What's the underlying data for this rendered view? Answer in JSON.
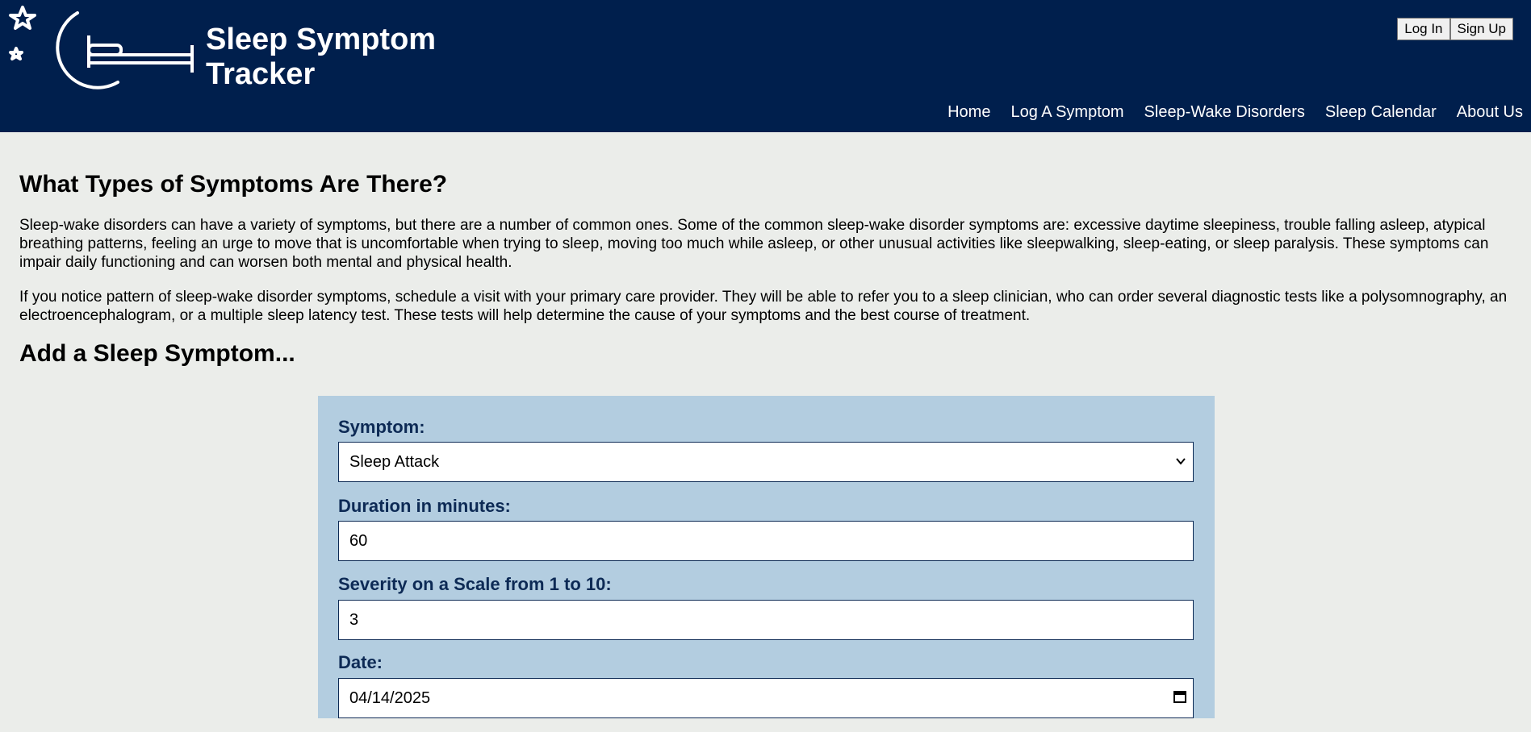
{
  "site": {
    "title_line1": "Sleep Symptom",
    "title_line2": "Tracker"
  },
  "auth": {
    "login": "Log In",
    "signup": "Sign Up"
  },
  "nav": [
    "Home",
    "Log A Symptom",
    "Sleep-Wake Disorders",
    "Sleep Calendar",
    "About Us"
  ],
  "intro": {
    "heading": "What Types of Symptoms Are There?",
    "p1": "Sleep-wake disorders can have a variety of symptoms, but there are a number of common ones. Some of the common sleep-wake disorder symptoms are: excessive daytime sleepiness, trouble falling asleep, atypical breathing patterns, feeling an urge to move that is uncomfortable when trying to sleep, moving too much while asleep, or other unusual activities like sleepwalking, sleep-eating, or sleep paralysis. These symptoms can impair daily functioning and can worsen both mental and physical health.",
    "p2": "If you notice pattern of sleep-wake disorder symptoms, schedule a visit with your primary care provider. They will be able to refer you to a sleep clinician, who can order several diagnostic tests like a polysomnography, an electroencephalogram, or a multiple sleep latency test. These tests will help determine the cause of your symptoms and the best course of treatment."
  },
  "form": {
    "heading": "Add a Sleep Symptom...",
    "symptom_label": "Symptom:",
    "symptom_value": "Sleep Attack",
    "duration_label": "Duration in minutes:",
    "duration_value": "60",
    "severity_label": "Severity on a Scale from 1 to 10:",
    "severity_value": "3",
    "date_label": "Date:",
    "date_value": "04/14/2025"
  },
  "colors": {
    "header_bg": "#001f4d",
    "page_bg": "#ebedea",
    "form_bg": "#b3cde0",
    "label": "#0d2a55"
  },
  "icons": [
    "moon-bed-stars-logo",
    "chevron-down-icon",
    "calendar-icon"
  ]
}
